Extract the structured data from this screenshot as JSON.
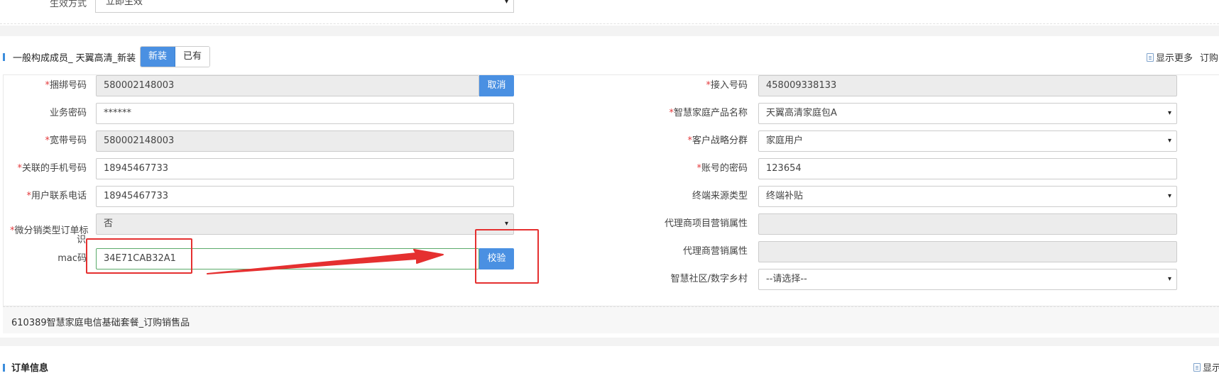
{
  "top_row": {
    "label": "生效方式",
    "select_value": "立即生效"
  },
  "section": {
    "title": "一般构成成员_ 天翼高清_新装",
    "toggle_new": "新装",
    "toggle_existing": "已有",
    "show_more": "显示更多",
    "order_cut": "订购"
  },
  "left_fields": {
    "bind_number": {
      "label": "捆绑号码",
      "value": "580002148003",
      "button": "取消"
    },
    "service_password": {
      "label": "业务密码",
      "value": "******"
    },
    "broadband_number": {
      "label": "宽带号码",
      "value": "580002148003"
    },
    "linked_mobile": {
      "label": "关联的手机号码",
      "value": "18945467733"
    },
    "contact_phone": {
      "label": "用户联系电话",
      "value": "18945467733"
    },
    "micro_distribution": {
      "label_line1": "微分销类型订单标",
      "label_line2": "识",
      "value": "否"
    },
    "mac": {
      "label": "mac码",
      "value": "34E71CAB32A1",
      "button": "校验"
    }
  },
  "right_fields": {
    "access_number": {
      "label": "接入号码",
      "value": "458009338133"
    },
    "product_name": {
      "label": "智慧家庭产品名称",
      "value": "天翼高清家庭包A"
    },
    "customer_segment": {
      "label": "客户战略分群",
      "value": "家庭用户"
    },
    "account_password": {
      "label": "账号的密码",
      "value": "123654"
    },
    "terminal_source": {
      "label": "终端来源类型",
      "value": "终端补贴"
    },
    "agent_project_attr": {
      "label": "代理商项目营销属性",
      "value": ""
    },
    "agent_attr": {
      "label": "代理商营销属性",
      "value": ""
    },
    "smart_community": {
      "label": "智慧社区/数字乡村",
      "value": "--请选择--"
    }
  },
  "product_line": "610389智慧家庭电信基础套餐_订购销售品",
  "order_section": {
    "title": "订单信息",
    "show_cut": "显示"
  },
  "colors": {
    "accent": "#4a90e2",
    "required": "#e4393c",
    "annotation": "#e53030",
    "readonly_bg": "#ececec"
  },
  "icons": {
    "caret": "▾",
    "document": "document-icon"
  }
}
